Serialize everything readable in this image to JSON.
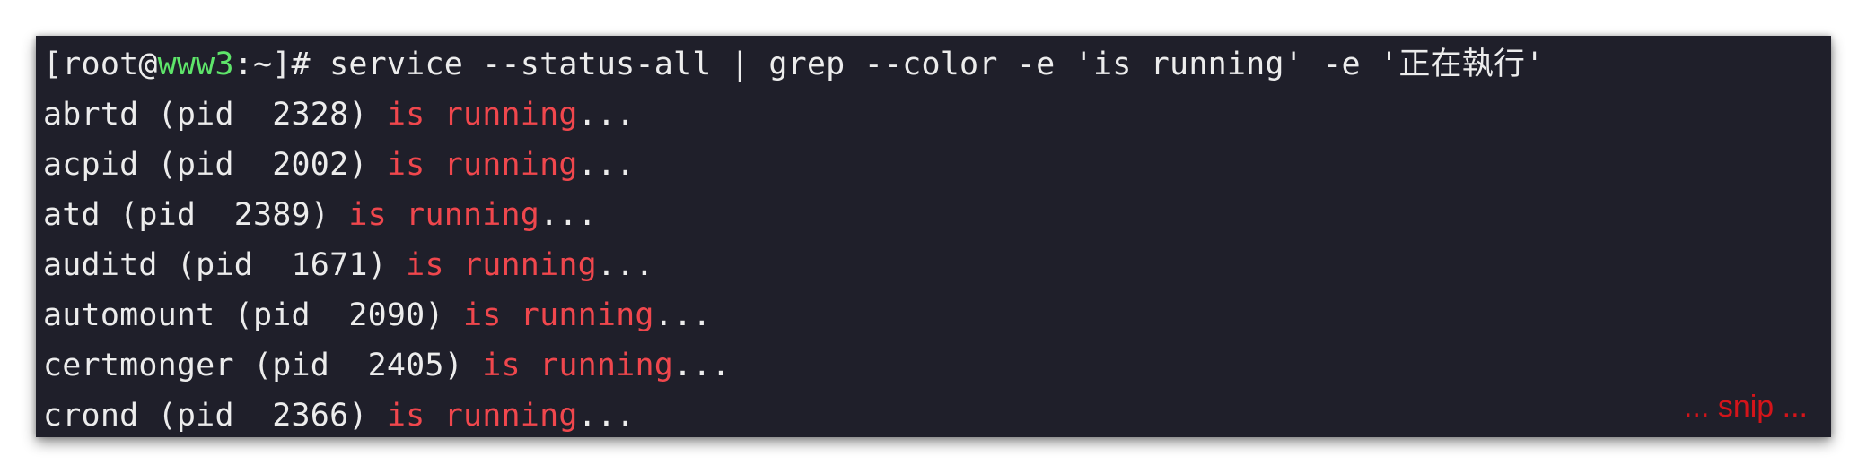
{
  "terminal": {
    "prompt": {
      "open": "[root@",
      "host": "www3",
      "rest": ":~]# ",
      "command": "service --status-all | grep --color -e 'is running' -e '正在執行'"
    },
    "lines": [
      {
        "pre": "abrtd (pid  2328) ",
        "match": "is running",
        "post": "..."
      },
      {
        "pre": "acpid (pid  2002) ",
        "match": "is running",
        "post": "..."
      },
      {
        "pre": "atd (pid  2389) ",
        "match": "is running",
        "post": "..."
      },
      {
        "pre": "auditd (pid  1671) ",
        "match": "is running",
        "post": "..."
      },
      {
        "pre": "automount (pid  2090) ",
        "match": "is running",
        "post": "..."
      },
      {
        "pre": "certmonger (pid  2405) ",
        "match": "is running",
        "post": "..."
      },
      {
        "pre": "crond (pid  2366) ",
        "match": "is running",
        "post": "..."
      }
    ],
    "annotation": "... snip ...",
    "colors": {
      "background": "#1f1f2a",
      "text": "#ececec",
      "host": "#5ee56a",
      "grep_match": "#f0474d",
      "annotation": "#d4141a"
    }
  }
}
